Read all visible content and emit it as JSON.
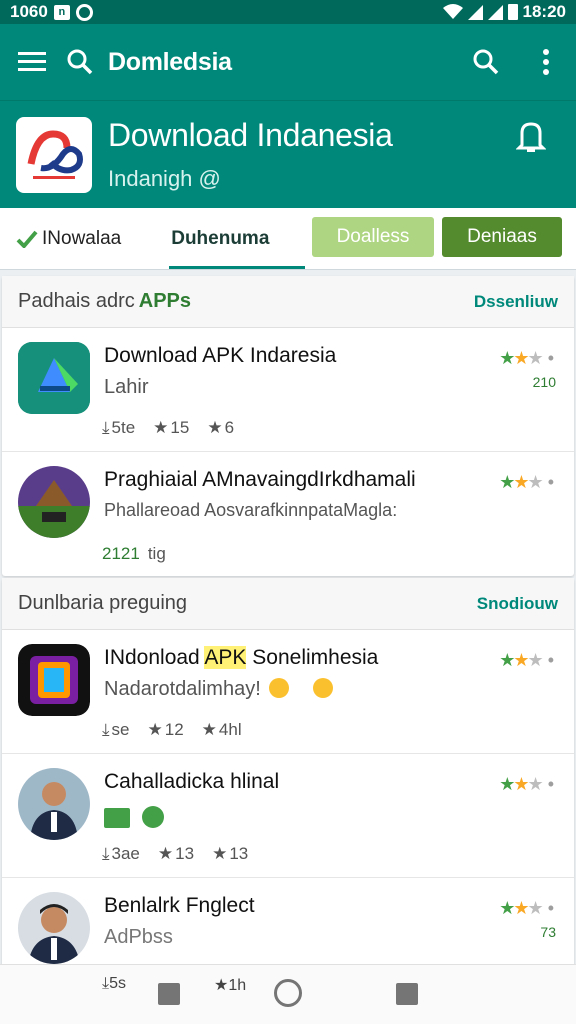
{
  "status_bar": {
    "left_text": "1060",
    "time": "18:20"
  },
  "toolbar": {
    "search_text": "Domledsia"
  },
  "header": {
    "title": "Download Indanesia",
    "subtitle": "Indanigh @"
  },
  "tabs": {
    "tab1": "INowalaa",
    "tab2": "Duhenuma",
    "chip1": "Doalless",
    "chip2": "Deniaas"
  },
  "sections": [
    {
      "title": "Padhais adrc",
      "accent": "APPs",
      "link": "Dssenliuw",
      "items": [
        {
          "title": "Download APK Indaresia",
          "subtitle": "Lahir",
          "meta": [
            "5te",
            "15",
            "6"
          ],
          "count": "210"
        },
        {
          "title": "Praghiaial AMnavaingdIrkdhamali",
          "subtitle": "Phallareoad AosvarafkinnpataMagla:",
          "meta_green": "2121",
          "meta_extra": "tig"
        }
      ]
    },
    {
      "title": "Dunlbaria preguing",
      "link": "Snodiouw",
      "items": [
        {
          "title_pre": "INdonload ",
          "title_hl": "APK",
          "title_post": " Sonelimhesia",
          "subtitle": "Nadarotdalimhay!",
          "meta": [
            "se",
            "12",
            "4hl"
          ]
        },
        {
          "title": "Cahalladicka hlinal",
          "meta": [
            "3ae",
            "13",
            "13"
          ]
        },
        {
          "title": "Benlalrk Fnglect",
          "subtitle": "AdPbss",
          "count": "73"
        }
      ]
    }
  ],
  "navbar": {
    "left": "5s",
    "mid": "1h"
  },
  "colors": {
    "primary": "#00897b",
    "primary_dark": "#00695c",
    "accent_green": "#558b2f",
    "light_green": "#aed581",
    "star_green": "#43a047",
    "star_yellow": "#f9a825"
  }
}
